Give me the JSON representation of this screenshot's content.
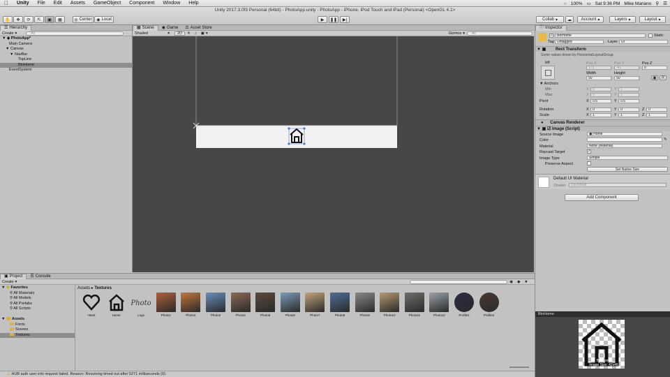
{
  "menubar": {
    "items": [
      "Unity",
      "File",
      "Edit",
      "Assets",
      "GameObject",
      "Component",
      "Window",
      "Help"
    ],
    "right": {
      "battery": "100%",
      "clock": "Sat 9:36 PM",
      "user": "Mike Mariano"
    }
  },
  "window_title": "Unity 2017.3.0f3 Personal (64bit) - PhotoApp.unity - PhotoApp - iPhone, iPod Touch and iPad (Personal) <OpenGL 4.1>",
  "toolbar": {
    "pivot": "Center",
    "space": "Local",
    "collab": "Collab",
    "account": "Account",
    "layers": "Layers",
    "layout": "Layout"
  },
  "hierarchy": {
    "tab": "Hierarchy",
    "create": "Create",
    "search_placeholder": "All",
    "items": [
      {
        "label": "PhotoApp*"
      },
      {
        "label": "Main Camera"
      },
      {
        "label": "Canvas"
      },
      {
        "label": "NavBar"
      },
      {
        "label": "TopLine"
      },
      {
        "label": "BtnHome"
      },
      {
        "label": "EventSystem"
      }
    ]
  },
  "scene": {
    "tabs": [
      "Scene",
      "Game",
      "Asset Store"
    ],
    "shading": "Shaded",
    "mode": "2D",
    "gizmos": "Gizmos",
    "search_placeholder": "All"
  },
  "inspector": {
    "tab": "Inspector",
    "name": "BtnHome",
    "static_label": "Static",
    "tag_label": "Tag",
    "tag_value": "Untagged",
    "layer_label": "Layer",
    "layer_value": "UI",
    "rect_transform": {
      "title": "Rect Transform",
      "note": "Some values driven by HorizontalLayoutGroup.",
      "anchor_preset": "left",
      "pos_x_label": "Pos X",
      "pos_x": "175",
      "pos_y_label": "Pos Y",
      "pos_y": "-41",
      "pos_z_label": "Pos Z",
      "pos_z": "0",
      "width_label": "Width",
      "width": "50",
      "height_label": "Height",
      "height": "50",
      "anchors_label": "Anchors",
      "min_label": "Min",
      "min_x": "0",
      "min_y": "1",
      "max_label": "Max",
      "max_x": "0",
      "max_y": "1",
      "pivot_label": "Pivot",
      "pivot_x": "0.5",
      "pivot_y": "0.5",
      "rotation_label": "Rotation",
      "rot_x": "0",
      "rot_y": "0",
      "rot_z": "0",
      "scale_label": "Scale",
      "scale_x": "1",
      "scale_y": "1",
      "scale_z": "1"
    },
    "canvas_renderer": {
      "title": "Canvas Renderer"
    },
    "image": {
      "title": "Image (Script)",
      "source_label": "Source Image",
      "source": "Home",
      "color_label": "Color",
      "material_label": "Material",
      "material": "None (Material)",
      "raycast_label": "Raycast Target",
      "type_label": "Image Type",
      "type": "Simple",
      "preserve_label": "Preserve Aspect",
      "native_button": "Set Native Size"
    },
    "material": {
      "title": "Default UI Material",
      "shader_label": "Shader",
      "shader": "UI/Default"
    },
    "add_component": "Add Component"
  },
  "project": {
    "tabs": [
      "Project",
      "Console"
    ],
    "create": "Create",
    "breadcrumb": [
      "Assets",
      "Textures"
    ],
    "tree": [
      {
        "label": "Favorites"
      },
      {
        "label": "All Materials"
      },
      {
        "label": "All Models"
      },
      {
        "label": "All Prefabs"
      },
      {
        "label": "All Scripts"
      },
      {
        "label": "Assets"
      },
      {
        "label": "Fonts"
      },
      {
        "label": "Scenes"
      },
      {
        "label": "Textures"
      }
    ],
    "assets": [
      {
        "label": "Heart",
        "kind": "heart"
      },
      {
        "label": "Home",
        "kind": "home"
      },
      {
        "label": "Logo",
        "kind": "logo"
      },
      {
        "label": "Photo1",
        "kind": "photo",
        "color": "#b0603a"
      },
      {
        "label": "Photo2",
        "kind": "photo",
        "color": "#c2773a"
      },
      {
        "label": "Photo3",
        "kind": "photo",
        "color": "#6a8fbf"
      },
      {
        "label": "Photo4",
        "kind": "photo",
        "color": "#8c6a55"
      },
      {
        "label": "Photo5",
        "kind": "photo",
        "color": "#5d4a3e"
      },
      {
        "label": "Photo6",
        "kind": "photo",
        "color": "#7b9bb8"
      },
      {
        "label": "Photo7",
        "kind": "photo",
        "color": "#c4a57a"
      },
      {
        "label": "Photo8",
        "kind": "photo",
        "color": "#4e6f99"
      },
      {
        "label": "Photo9",
        "kind": "photo",
        "color": "#8a8a8a"
      },
      {
        "label": "Photo10",
        "kind": "photo",
        "color": "#b59a73"
      },
      {
        "label": "Photo11",
        "kind": "photo",
        "color": "#6f6f6a"
      },
      {
        "label": "Photo12",
        "kind": "photo",
        "color": "#9aa2a8"
      },
      {
        "label": "Profile1",
        "kind": "profile",
        "color": "#2b2b44"
      },
      {
        "label": "Profile2",
        "kind": "profile",
        "color": "#4a3a33"
      }
    ]
  },
  "preview": {
    "title": "BtnHome",
    "line1": "BtnHome",
    "line2": "Image Size: 42x46"
  },
  "status": "HUB auth user info request failed. Reason: Resolving timed out after 5271 milliseconds (0)."
}
